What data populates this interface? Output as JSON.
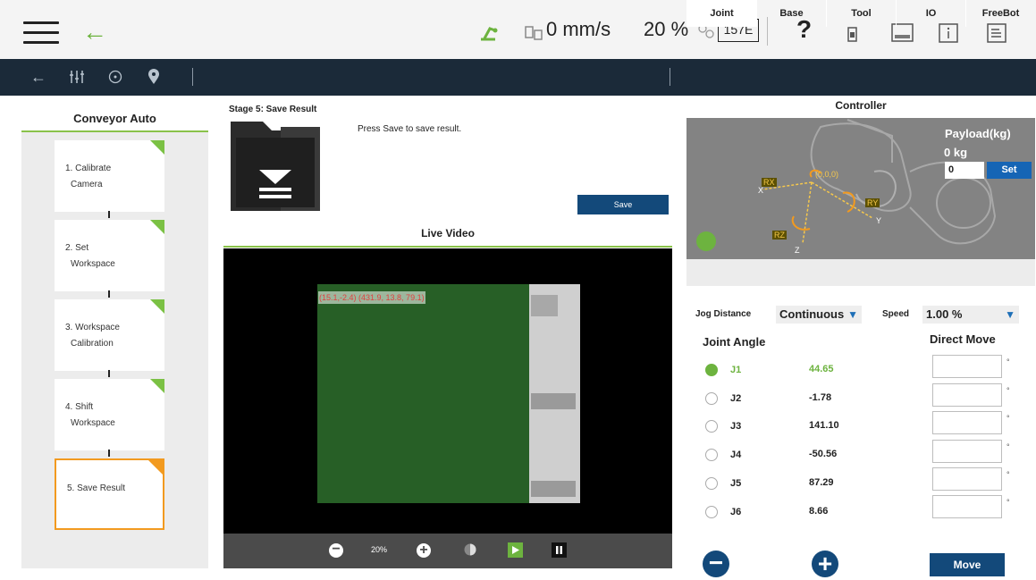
{
  "topbar": {
    "speed": "0 mm/s",
    "percent": "20 %",
    "code": "157E",
    "help": "?"
  },
  "left": {
    "title": "Conveyor Auto",
    "steps": [
      {
        "line1": "1. Calibrate",
        "line2": "Camera"
      },
      {
        "line1": "2. Set",
        "line2": "Workspace"
      },
      {
        "line1": "3. Workspace",
        "line2": "Calibration"
      },
      {
        "line1": "4. Shift",
        "line2": "Workspace"
      },
      {
        "line1": "5. Save Result",
        "line2": ""
      }
    ]
  },
  "stage": {
    "title": "Stage 5: Save Result",
    "text": "Press Save to save result.",
    "save_label": "Save"
  },
  "video": {
    "title": "Live Video",
    "coord": "(15.1,-2.4) (431.9, 13.8, 79.1)",
    "zoom": "20%"
  },
  "controller": {
    "title": "Controller",
    "payload_label": "Payload(kg)",
    "payload_value": "0 kg",
    "payload_input": "0",
    "set_label": "Set",
    "axes": {
      "rx": "RX",
      "ry": "RY",
      "rz": "RZ",
      "x": "X",
      "y": "Y",
      "z": "Z",
      "origin": "(0,0,0)"
    },
    "tabs": [
      "Joint",
      "Base",
      "Tool",
      "IO",
      "FreeBot"
    ],
    "jog_distance_label": "Jog Distance",
    "jog_distance_value": "Continuous",
    "speed_label": "Speed",
    "speed_value": "1.00 %",
    "joint_angle_label": "Joint Angle",
    "direct_move_label": "Direct Move",
    "joints": [
      {
        "name": "J1",
        "value": "44.65"
      },
      {
        "name": "J2",
        "value": "-1.78"
      },
      {
        "name": "J3",
        "value": "141.10"
      },
      {
        "name": "J4",
        "value": "-50.56"
      },
      {
        "name": "J5",
        "value": "87.29"
      },
      {
        "name": "J6",
        "value": "8.66"
      }
    ],
    "degree_symbol": "°",
    "move_label": "Move"
  },
  "colors": {
    "accent_green": "#6db33f",
    "button_blue": "#13497a",
    "nav_bg": "#1b2a39",
    "active_step": "#f29a1f"
  }
}
